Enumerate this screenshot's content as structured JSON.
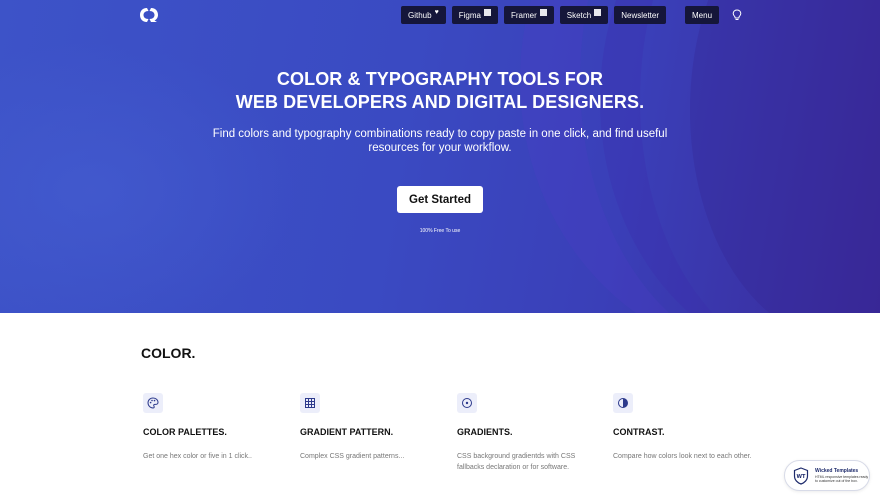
{
  "nav": {
    "items": [
      {
        "label": "Github",
        "icon": "heart-icon"
      },
      {
        "label": "Figma",
        "icon": "external-icon"
      },
      {
        "label": "Framer",
        "icon": "external-icon"
      },
      {
        "label": "Sketch",
        "icon": "external-icon"
      },
      {
        "label": "Newsletter",
        "icon": ""
      }
    ],
    "menu_label": "Menu",
    "heart_glyph": "♥"
  },
  "hero": {
    "title_line1": "COLOR & TYPOGRAPHY TOOLS FOR",
    "title_line2": "WEB DEVELOPERS AND DIGITAL DESIGNERS.",
    "subtitle": "Find colors and typography combinations ready to copy paste in one click, and find useful resources for your workflow.",
    "cta_label": "Get Started",
    "free_note": "100% Free To use"
  },
  "color_section": {
    "title": "COLOR.",
    "cards": [
      {
        "title": "COLOR PALETTES.",
        "desc": "Get one hex color or five in 1 click..",
        "icon": "palette-icon"
      },
      {
        "title": "GRADIENT PATTERN.",
        "desc": "Complex CSS gradient patterns...",
        "icon": "grid-icon"
      },
      {
        "title": "GRADIENTS.",
        "desc": "CSS background gradientds with CSS fallbacks declaration or for software.",
        "icon": "target-icon"
      },
      {
        "title": "CONTRAST.",
        "desc": "Compare how colors look next to each other.",
        "icon": "contrast-icon"
      }
    ]
  },
  "badge": {
    "title": "Wicked Templates",
    "desc": "HTML responsive templates ready to customize out of the box.",
    "logo_text": "WT"
  },
  "colors": {
    "hero_start": "#3d53c8",
    "hero_end": "#3a2a9a",
    "nav_button": "#15163a",
    "icon_box": "#eceefa",
    "icon_stroke": "#2d3a8c"
  }
}
